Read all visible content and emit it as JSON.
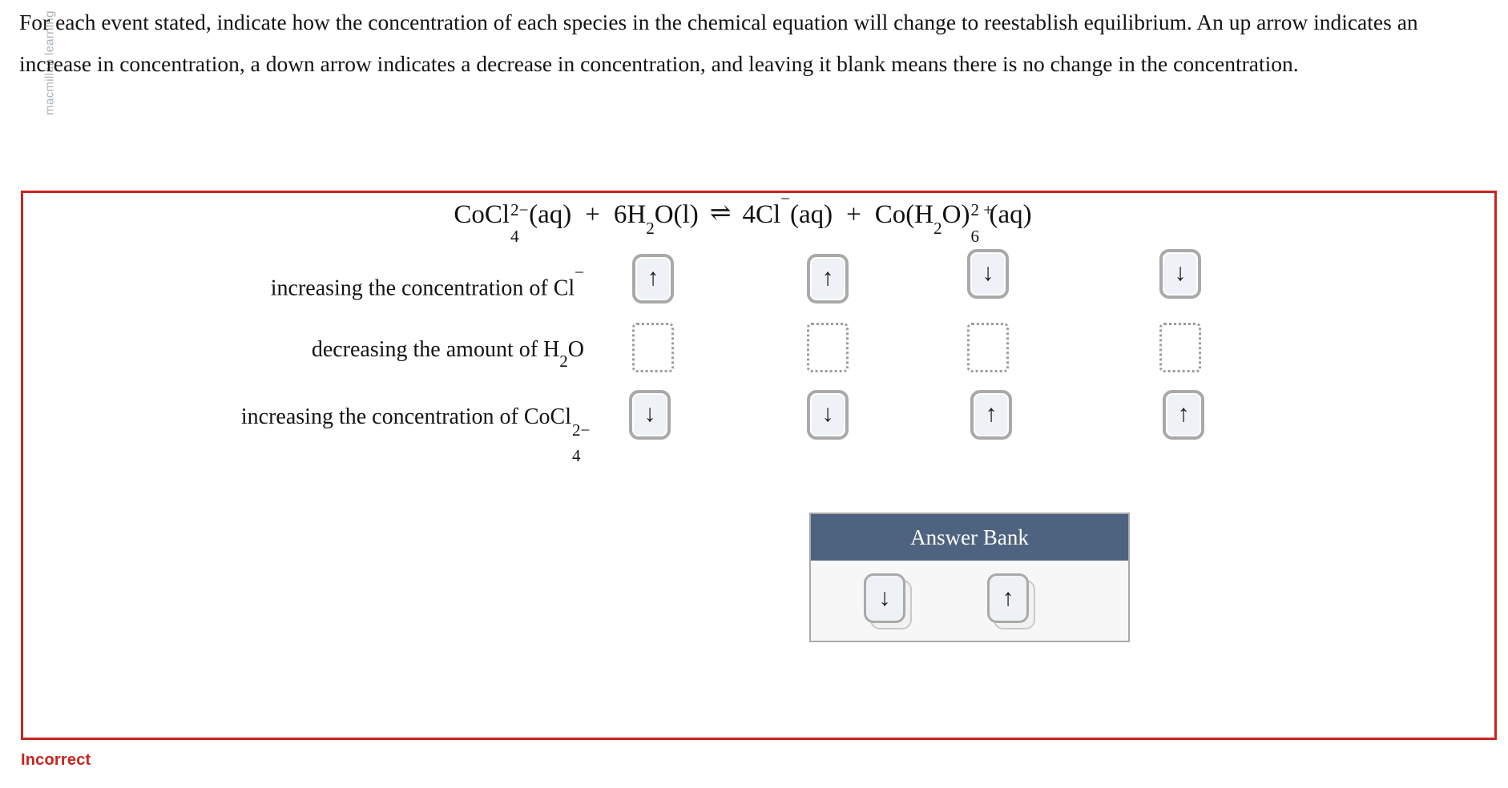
{
  "watermark": "macmillan learning",
  "instructions": "For each event stated, indicate how the concentration of each species in the chemical equation will change to reestablish equilibrium. An up arrow indicates an increase in concentration, a down arrow indicates a decrease in concentration, and leaving it blank means there is no change in the concentration.",
  "equation": {
    "reactant1": {
      "formula": "CoCl",
      "subscript": "4",
      "charge": "2−",
      "state": "(aq)"
    },
    "plus1": "+",
    "reactant2": {
      "coefficient": "6",
      "element1": "H",
      "subscript": "2",
      "element2": "O",
      "state": "(l)"
    },
    "equilibrium_arrow": "⇌",
    "product1": {
      "coefficient": "4",
      "formula": "Cl",
      "charge": "−",
      "state": "(aq)"
    },
    "plus2": "+",
    "product2": {
      "formula_open": "Co(H",
      "subscript_inner": "2",
      "formula_mid": "O)",
      "subscript": "6",
      "charge": "2 +",
      "state": "(aq)"
    }
  },
  "columns": [
    {
      "id": "col-cocl4",
      "species": "CoCl4 2-(aq)"
    },
    {
      "id": "col-h2o",
      "species": "6H2O(l)"
    },
    {
      "id": "col-cl",
      "species": "4Cl-(aq)"
    },
    {
      "id": "col-cohydrate",
      "species": "Co(H2O)6 2+(aq)"
    }
  ],
  "rows": [
    {
      "id": "row-increase-cl",
      "label_plain": "increasing the concentration of Cl⁻",
      "label": {
        "prefix": "increasing the concentration of Cl",
        "charge": "−"
      },
      "answers": [
        "↑",
        "↑",
        "↓",
        "↓"
      ]
    },
    {
      "id": "row-decrease-h2o",
      "label_plain": "decreasing the amount of H2O",
      "label": {
        "prefix": "decreasing the amount of H",
        "subscript": "2",
        "suffix": "O"
      },
      "answers": [
        "",
        "",
        "",
        ""
      ]
    },
    {
      "id": "row-increase-cocl4",
      "label_plain": "increasing the concentration of CoCl4 2-",
      "label": {
        "prefix": "increasing the concentration of CoCl",
        "subscript": "4",
        "charge": "2−"
      },
      "answers": [
        "↓",
        "↓",
        "↑",
        "↑"
      ]
    }
  ],
  "answer_bank": {
    "title": "Answer Bank",
    "tiles": [
      {
        "id": "bank-tile-down",
        "glyph": "↓",
        "name": "down-arrow"
      },
      {
        "id": "bank-tile-up",
        "glyph": "↑",
        "name": "up-arrow"
      }
    ]
  },
  "status": {
    "text": "Incorrect",
    "color": "#c8241f"
  },
  "colors": {
    "error_border": "#c8241f",
    "error_text": "#c8241f",
    "bank_header": "#4e6380",
    "bank_body": "#f7f7f7",
    "tile_border": "#a9a9a9",
    "tile_fill": "#eef1f6",
    "dropzone_border": "#9d9d9d"
  }
}
